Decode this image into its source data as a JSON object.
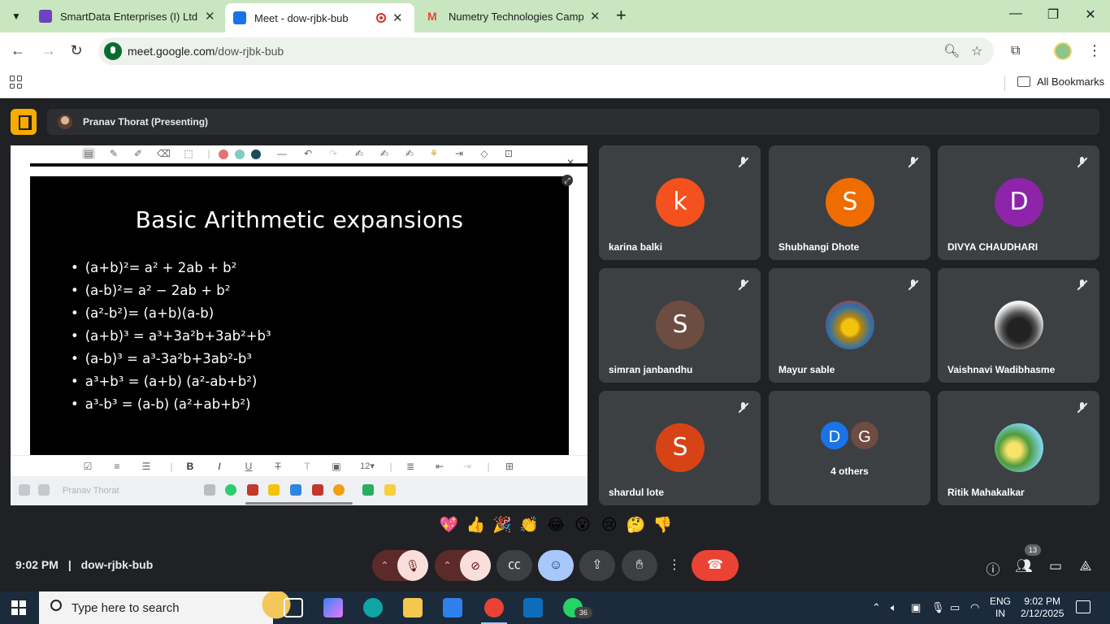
{
  "browser": {
    "tabs": [
      {
        "title": "SmartData Enterprises (I) Ltd. C",
        "favicon_color": "#6f42c1",
        "active": false
      },
      {
        "title": "Meet - dow-rjbk-bub",
        "favicon_color": "#1a73e8",
        "active": true
      },
      {
        "title": "Numetry Technologies Campus",
        "favicon_color": "#ea4335",
        "active": false
      }
    ],
    "url_host": "meet.google.com",
    "url_path": "/dow-rjbk-bub",
    "bookmarks_label": "All Bookmarks"
  },
  "meet": {
    "presenting_label": "Pranav Thorat (Presenting)",
    "slide": {
      "title": "Basic Arithmetic expansions",
      "formulas": [
        "(a+b)²= a² + 2ab + b²",
        "(a-b)²= a² − 2ab + b²",
        "(a²-b²)= (a+b)(a-b)",
        "(a+b)³ = a³+3a²b+3ab²+b³",
        "(a-b)³ = a³-3a²b+3ab²-b³",
        "a³+b³ = (a+b) (a²-ab+b²)",
        "a³-b³ = (a-b) (a²+ab+b²)"
      ]
    },
    "shared_screen_taskbar_title": "Pranav Thorat",
    "shared_screen_font_size": "12",
    "participants": [
      {
        "name": "karina balki",
        "initial": "k",
        "color": "#f4511e"
      },
      {
        "name": "Shubhangi Dhote",
        "initial": "S",
        "color": "#ef6c00"
      },
      {
        "name": "DIVYA CHAUDHARI",
        "initial": "D",
        "color": "#8e24aa"
      },
      {
        "name": "simran janbandhu",
        "initial": "S",
        "color": "#6d4c41"
      },
      {
        "name": "Mayur sable",
        "initial": "",
        "color": "photo"
      },
      {
        "name": "Vaishnavi Wadibhasme",
        "initial": "",
        "color": "photo"
      },
      {
        "name": "shardul lote",
        "initial": "S",
        "color": "#d84315"
      },
      {
        "name": "Ritik Mahakalkar",
        "initial": "",
        "color": "photo"
      }
    ],
    "others": {
      "label": "4 others",
      "initials": [
        "D",
        "G"
      ],
      "colors": [
        "#1a73e8",
        "#6d4c41"
      ]
    },
    "reactions": [
      "💖",
      "👍",
      "🎉",
      "👏",
      "😂",
      "😮",
      "😢",
      "🤔",
      "👎"
    ],
    "time": "9:02 PM",
    "separator": "|",
    "meeting_code": "dow-rjbk-bub",
    "people_count": "13"
  },
  "windows": {
    "search_placeholder": "Type here to search",
    "whatsapp_badge": "36",
    "lang_line1": "ENG",
    "lang_line2": "IN",
    "clock_time": "9:02 PM",
    "clock_date": "2/12/2025"
  },
  "colors": {
    "meet_bg": "#202124",
    "tile_bg": "#3c4043",
    "end_call": "#ea4335",
    "mic_off_bg": "#f9dedc",
    "reaction_bg": "#a8c7fa",
    "present_accent": "#f9ab00"
  }
}
